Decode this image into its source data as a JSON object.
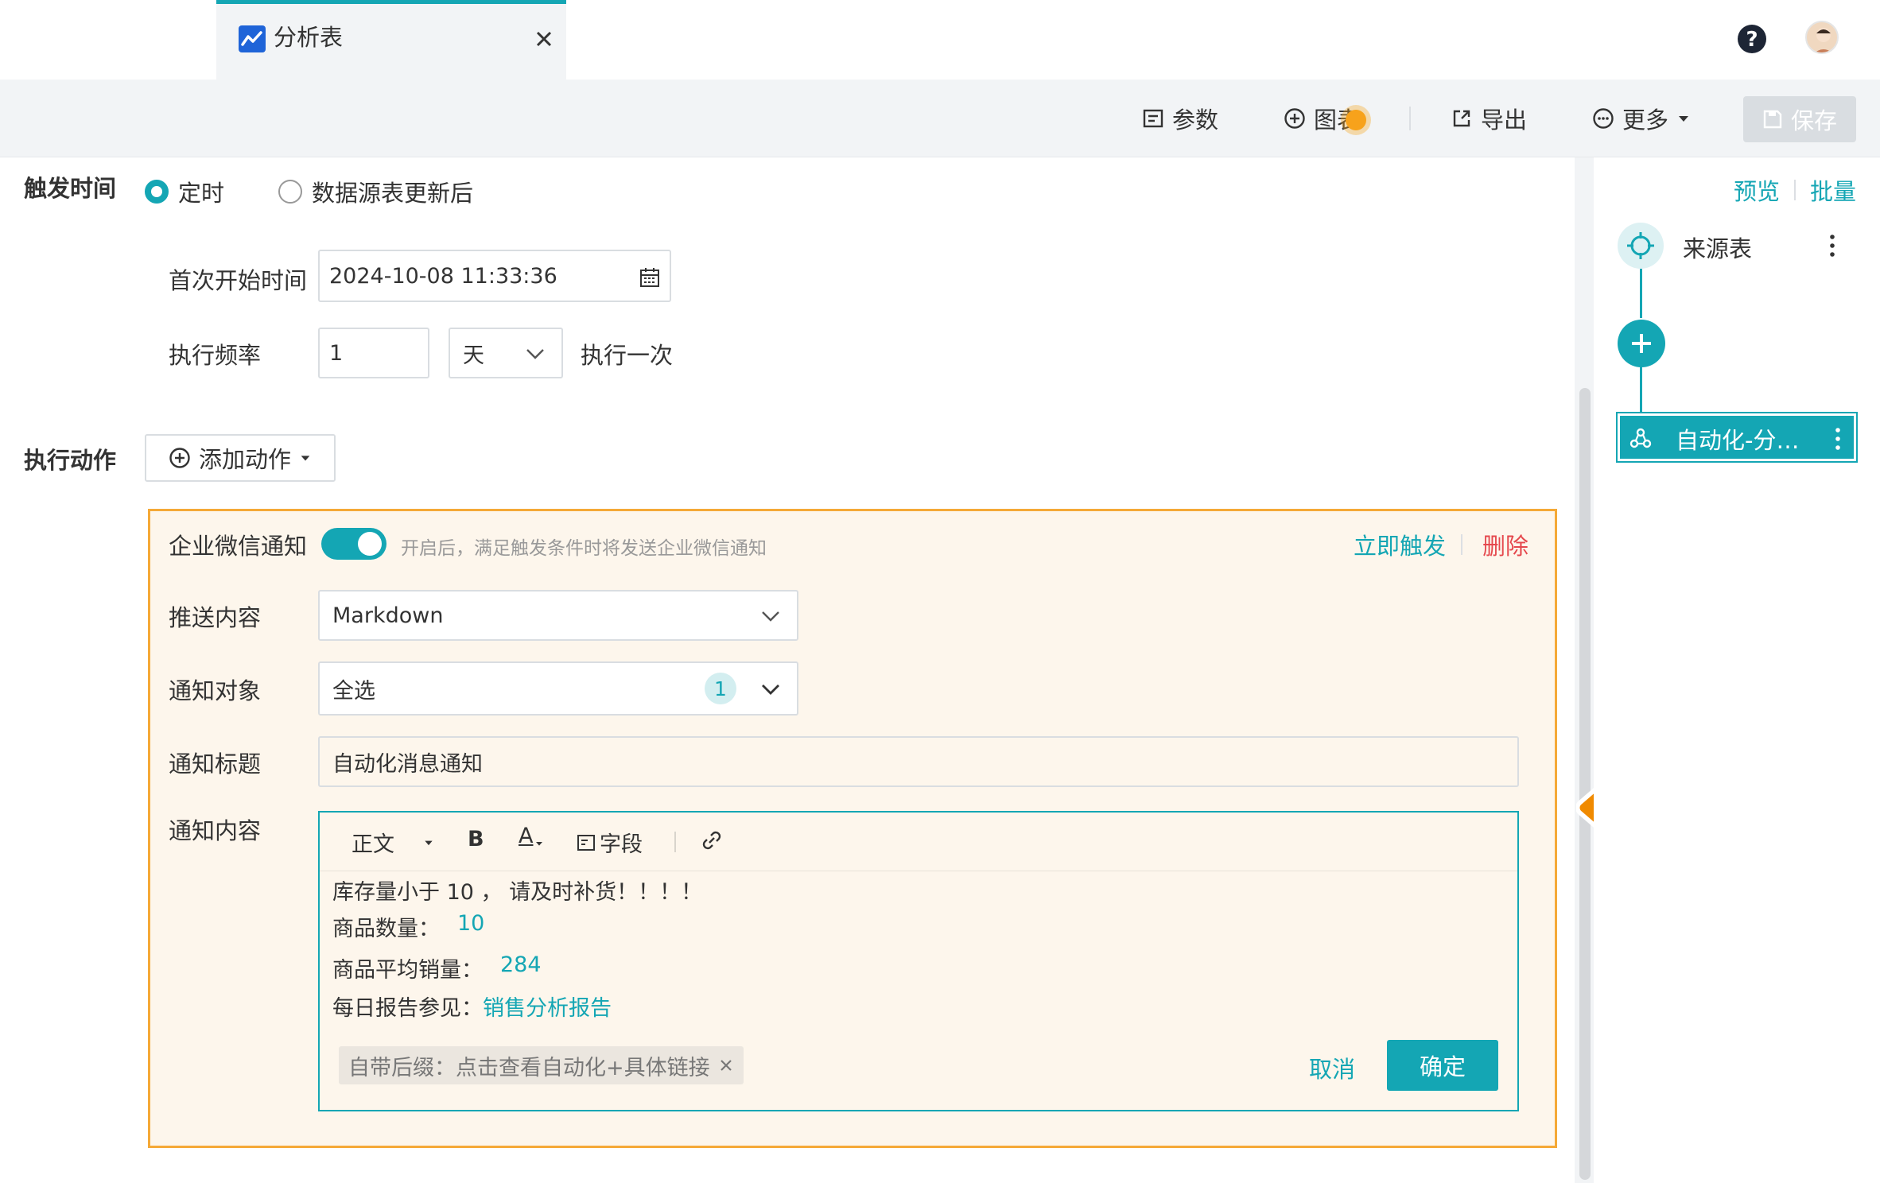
{
  "tab": {
    "title": "分析表"
  },
  "toolbar": {
    "params": "参数",
    "chart": "图表",
    "export": "导出",
    "more": "更多",
    "save": "保存"
  },
  "trigger": {
    "label": "触发时间",
    "option_scheduled": "定时",
    "option_after_update": "数据源表更新后",
    "first_start_label": "首次开始时间",
    "first_start_value": "2024-10-08 11:33:36",
    "frequency_label": "执行频率",
    "frequency_value": "1",
    "frequency_unit": "天",
    "frequency_suffix": "执行一次"
  },
  "action": {
    "label": "执行动作",
    "add_action": "添加动作"
  },
  "wecom": {
    "title": "企业微信通知",
    "toggle_on": true,
    "hint": "开启后，满足触发条件时将发送企业微信通知",
    "trigger_now": "立即触发",
    "delete": "删除",
    "push_content_label": "推送内容",
    "push_content_value": "Markdown",
    "notify_target_label": "通知对象",
    "notify_target_value": "全选",
    "notify_target_count": "1",
    "notify_title_label": "通知标题",
    "notify_title_value": "自动化消息通知",
    "notify_content_label": "通知内容"
  },
  "editor": {
    "style": "正文",
    "bold": "B",
    "font_color": "A",
    "field": "字段",
    "line1": "库存量小于 10 ， 请及时补货！！！！",
    "line2_label": "商品数量：",
    "line2_value": "10",
    "line3_label": "商品平均销量：",
    "line3_value": "284",
    "line4_label": "每日报告参见：",
    "line4_link": "销售分析报告",
    "suffix": "自带后缀：点击查看自动化+具体链接",
    "cancel": "取消",
    "confirm": "确定"
  },
  "flow": {
    "preview": "预览",
    "batch": "批量",
    "source_node": "来源表",
    "automation_node": "自动化-分…"
  },
  "colors": {
    "accent": "#14a6b4",
    "highlight_border": "#f5a937",
    "delete": "#e5484d",
    "arrow": "#f08a00"
  }
}
